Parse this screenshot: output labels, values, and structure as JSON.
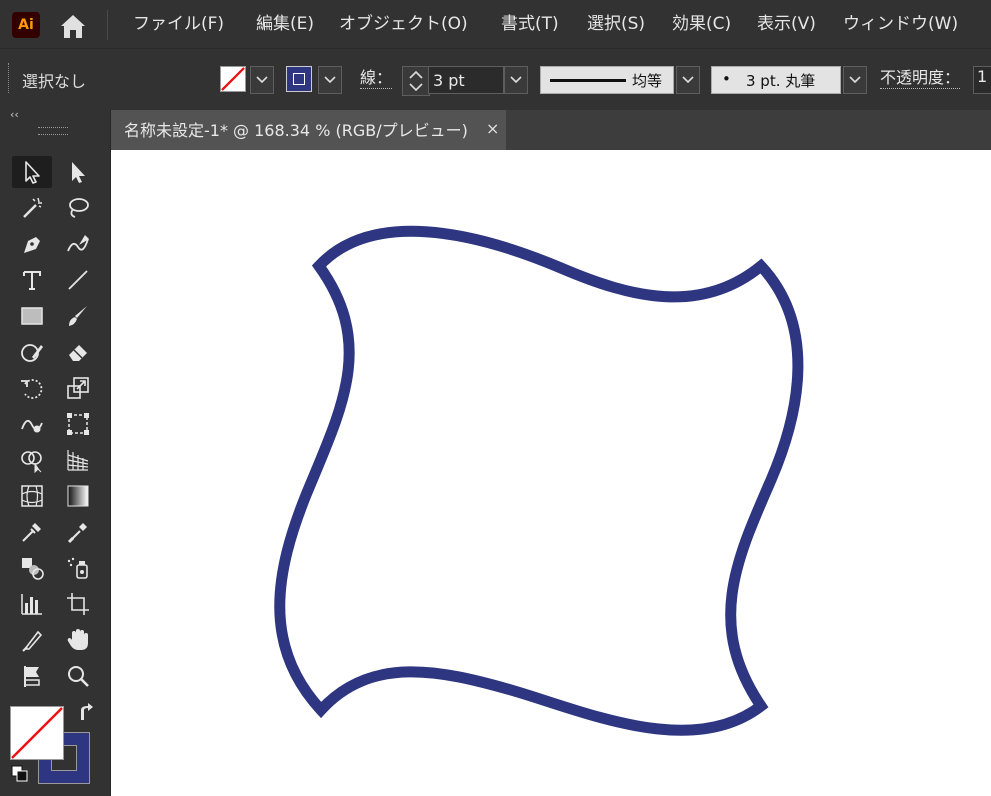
{
  "app": {
    "logo": "Ai"
  },
  "menu": {
    "items": [
      "ファイル(F)",
      "編集(E)",
      "オブジェクト(O)",
      "書式(T)",
      "選択(S)",
      "効果(C)",
      "表示(V)",
      "ウィンドウ(W)"
    ]
  },
  "control_bar": {
    "selection": "選択なし",
    "stroke_label": "線：",
    "stroke_weight": "3 pt",
    "profile_label": "均等",
    "brush_dot": "•",
    "brush_label": "3 pt. 丸筆",
    "opacity_label": "不透明度：",
    "opacity_value": "1"
  },
  "document": {
    "tab_title": "名称未設定-1* @ 168.34 % (RGB/プレビュー)",
    "close_glyph": "×"
  },
  "colors": {
    "stroke": "#2e3681",
    "fill": "none",
    "canvas": "#ffffff",
    "ui_dark": "#323232",
    "logo_text": "#ff9a00"
  },
  "tools": [
    [
      "selection-tool",
      "direct-selection-tool"
    ],
    [
      "magic-wand-tool",
      "lasso-tool"
    ],
    [
      "pen-tool",
      "curvature-tool"
    ],
    [
      "type-tool",
      "line-segment-tool"
    ],
    [
      "rectangle-tool",
      "paintbrush-tool"
    ],
    [
      "shaper-tool",
      "eraser-tool"
    ],
    [
      "rotate-tool",
      "scale-tool"
    ],
    [
      "warp-tool",
      "free-transform-tool"
    ],
    [
      "shape-builder-tool",
      "perspective-grid-tool"
    ],
    [
      "mesh-tool",
      "gradient-tool"
    ],
    [
      "eyedropper-tool",
      "measure-tool"
    ],
    [
      "blend-tool",
      "symbol-sprayer-tool"
    ],
    [
      "column-graph-tool",
      "artboard-tool"
    ],
    [
      "slice-tool",
      "hand-tool"
    ],
    [
      "puppet-warp-tool",
      "zoom-tool"
    ]
  ]
}
